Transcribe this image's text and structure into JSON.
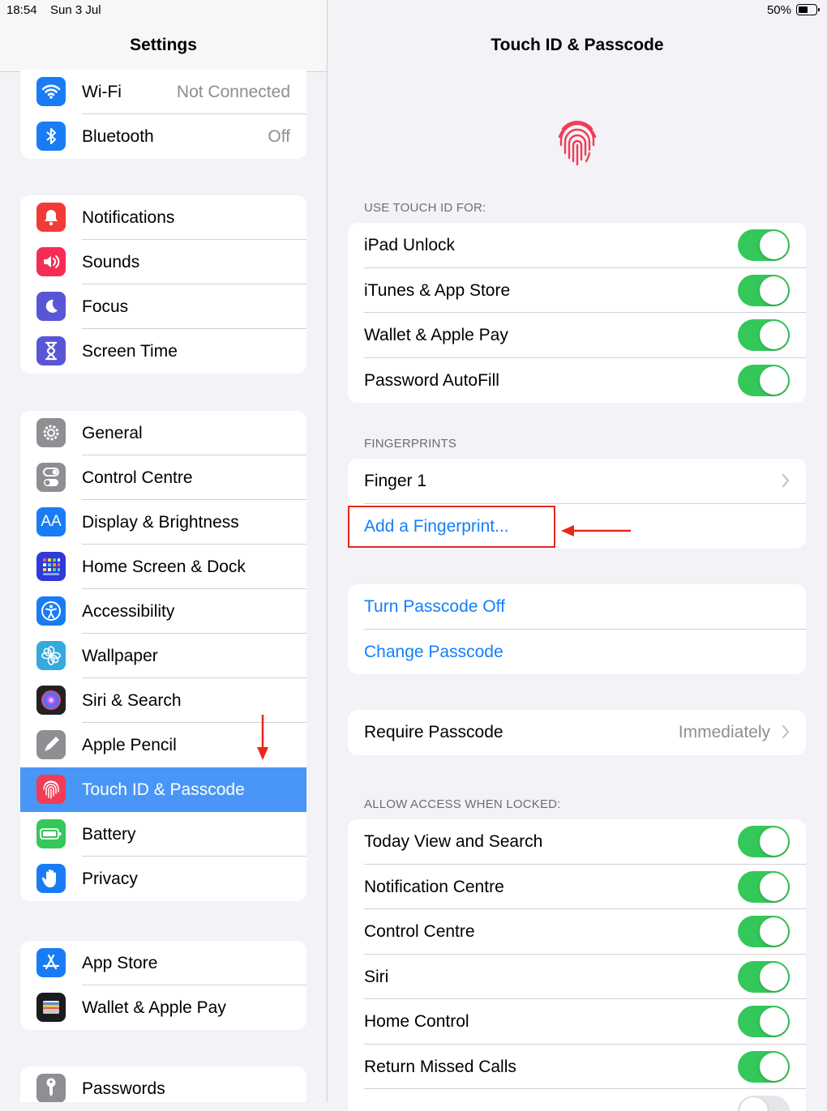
{
  "status_bar": {
    "time": "18:54",
    "date": "Sun 3 Jul",
    "battery_percent": "50%"
  },
  "sidebar": {
    "title": "Settings",
    "groups": [
      [
        {
          "label": "Wi-Fi",
          "value": "Not Connected",
          "icon": "wifi-icon",
          "color": "#1a7cf5"
        },
        {
          "label": "Bluetooth",
          "value": "Off",
          "icon": "bluetooth-icon",
          "color": "#1a7cf5"
        }
      ],
      [
        {
          "label": "Notifications",
          "icon": "bell-icon",
          "color": "#f23b36"
        },
        {
          "label": "Sounds",
          "icon": "speaker-icon",
          "color": "#f52d55"
        },
        {
          "label": "Focus",
          "icon": "moon-icon",
          "color": "#5956d6"
        },
        {
          "label": "Screen Time",
          "icon": "hourglass-icon",
          "color": "#5956d6"
        }
      ],
      [
        {
          "label": "General",
          "icon": "gear-icon",
          "color": "#8e8e93"
        },
        {
          "label": "Control Centre",
          "icon": "switches-icon",
          "color": "#8e8e93"
        },
        {
          "label": "Display & Brightness",
          "icon": "text-size-icon",
          "color": "#1a7cf5"
        },
        {
          "label": "Home Screen & Dock",
          "icon": "app-grid-icon",
          "color": "#2e3bd6"
        },
        {
          "label": "Accessibility",
          "icon": "accessibility-icon",
          "color": "#1a7cf5"
        },
        {
          "label": "Wallpaper",
          "icon": "flower-icon",
          "color": "#35aadc"
        },
        {
          "label": "Siri & Search",
          "icon": "siri-icon",
          "color": "#222222"
        },
        {
          "label": "Apple Pencil",
          "icon": "pencil-icon",
          "color": "#8e8e93"
        },
        {
          "label": "Touch ID & Passcode",
          "icon": "fingerprint-icon",
          "color": "#f23b55",
          "selected": true
        },
        {
          "label": "Battery",
          "icon": "battery-icon",
          "color": "#34c759"
        },
        {
          "label": "Privacy",
          "icon": "hand-icon",
          "color": "#1a7cf5"
        }
      ],
      [
        {
          "label": "App Store",
          "icon": "app-store-icon",
          "color": "#1a7cf5"
        },
        {
          "label": "Wallet & Apple Pay",
          "icon": "wallet-icon",
          "color": "#1c1c1e"
        }
      ],
      [
        {
          "label": "Passwords",
          "icon": "key-icon",
          "color": "#8e8e93"
        }
      ]
    ]
  },
  "detail": {
    "title": "Touch ID & Passcode",
    "use_touch_id": {
      "header": "USE TOUCH ID FOR:",
      "items": [
        {
          "label": "iPad Unlock",
          "on": true
        },
        {
          "label": "iTunes & App Store",
          "on": true
        },
        {
          "label": "Wallet & Apple Pay",
          "on": true
        },
        {
          "label": "Password AutoFill",
          "on": true
        }
      ]
    },
    "fingerprints": {
      "header": "FINGERPRINTS",
      "items": [
        "Finger 1"
      ],
      "add_label": "Add a Fingerprint..."
    },
    "passcode": {
      "turn_off": "Turn Passcode Off",
      "change": "Change Passcode"
    },
    "require": {
      "label": "Require Passcode",
      "value": "Immediately"
    },
    "allow_access": {
      "header": "ALLOW ACCESS WHEN LOCKED:",
      "items": [
        {
          "label": "Today View and Search",
          "on": true
        },
        {
          "label": "Notification Centre",
          "on": true
        },
        {
          "label": "Control Centre",
          "on": true
        },
        {
          "label": "Siri",
          "on": true
        },
        {
          "label": "Home Control",
          "on": true
        },
        {
          "label": "Return Missed Calls",
          "on": true
        }
      ]
    }
  },
  "colors": {
    "accent": "#147efb",
    "toggle_on": "#34c759",
    "selected_row": "#4a96f7",
    "annotation": "#e8271b"
  }
}
